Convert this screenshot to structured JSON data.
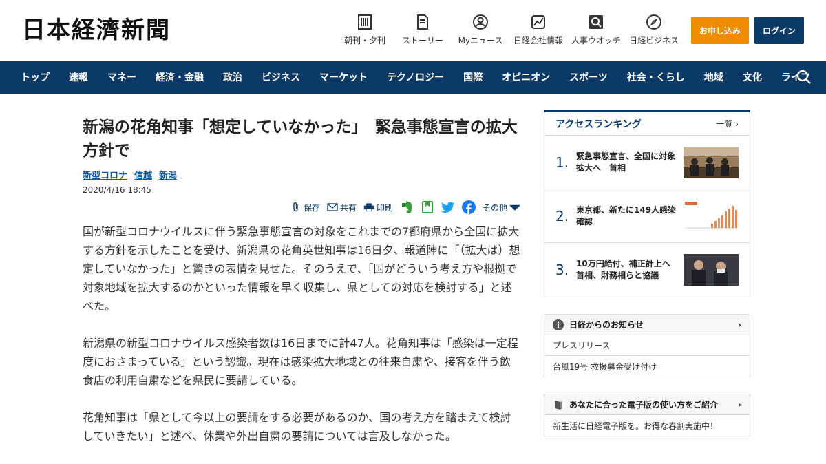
{
  "header": {
    "logo": "日本経濟新聞",
    "nav": [
      {
        "label": "朝刊・夕刊",
        "icon": "newspaper-icon"
      },
      {
        "label": "ストーリー",
        "icon": "document-icon"
      },
      {
        "label": "Myニュース",
        "icon": "person-icon"
      },
      {
        "label": "日経会社情報",
        "icon": "chart-icon"
      },
      {
        "label": "人事ウオッチ",
        "icon": "magnifier-icon"
      },
      {
        "label": "日経ビジネス",
        "icon": "compass-icon"
      }
    ],
    "subscribe_label": "お申し込み",
    "login_label": "ログイン"
  },
  "gnav": {
    "items": [
      "トップ",
      "速報",
      "マネー",
      "経済・金融",
      "政治",
      "ビジネス",
      "マーケット",
      "テクノロジー",
      "国際",
      "オピニオン",
      "スポーツ",
      "社会・くらし",
      "地域",
      "文化",
      "ライフ"
    ]
  },
  "article": {
    "title": "新潟の花角知事「想定していなかった」　緊急事態宣言の拡大方針で",
    "tags": [
      "新型コロナ",
      "信越",
      "新潟"
    ],
    "date": "2020/4/16 18:45",
    "share": {
      "save": "保存",
      "share": "共有",
      "print": "印刷",
      "other": "その他"
    },
    "paragraphs": [
      "国が新型コロナウイルスに伴う緊急事態宣言の対象をこれまでの7都府県から全国に拡大する方針を示したことを受け、新潟県の花角英世知事は16日夕、報道陣に「（拡大は）想定していなかった」と驚きの表情を見せた。そのうえで、「国がどういう考え方や根拠で対象地域を拡大するのかといった情報を早く収集し、県としての対応を検討する」と述べた。",
      "新潟県の新型コロナウイルス感染者数は16日までに計47人。花角知事は「感染は一定程度におさまっている」という認識。現在は感染拡大地域との往来自粛や、接客を伴う飲食店の利用自粛などを県民に要請している。",
      "花角知事は「県として今以上の要請をする必要があるのか、国の考え方を踏まえて検討していきたい」と述べ、休業や外出自粛の要請については言及しなかった。"
    ]
  },
  "ranking": {
    "title": "アクセスランキング",
    "more": "一覧",
    "items": [
      {
        "num": "1.",
        "text": "緊急事態宣言、全国に対象拡大へ　首相"
      },
      {
        "num": "2.",
        "text": "東京都、新たに149人感染確認"
      },
      {
        "num": "3.",
        "text": "10万円給付、補正計上へ　首相、財務相らと協議"
      }
    ]
  },
  "notice": {
    "title": "日経からのお知らせ",
    "rows": [
      "プレスリリース",
      "台風19号 救援募金受け付け"
    ]
  },
  "guide": {
    "title": "あなたに合った電子版の使い方をご紹介",
    "rows": [
      "新生活に日経電子版を。お得な春割実施中！"
    ]
  },
  "colors": {
    "navy": "#0c3a66",
    "orange": "#f08c00",
    "link": "#0c5ba3"
  }
}
